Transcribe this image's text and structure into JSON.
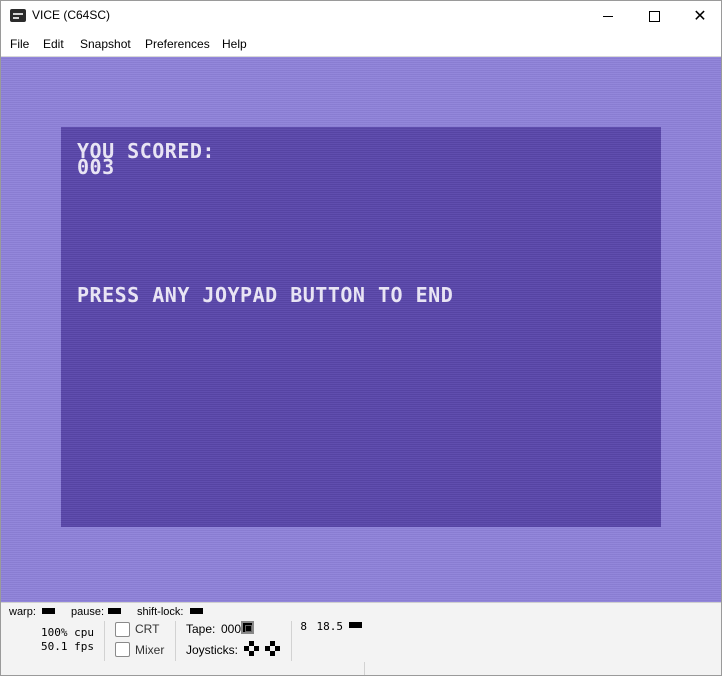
{
  "window": {
    "title": "VICE (C64SC)",
    "controls": {
      "minimize": "minimize",
      "maximize": "maximize",
      "close": "✕"
    }
  },
  "menu": [
    "File",
    "Edit",
    "Snapshot",
    "Preferences",
    "Help"
  ],
  "screen": {
    "line1": "YOU SCORED:",
    "line2": "003",
    "line3": "PRESS ANY JOYPAD BUTTON TO END",
    "border_color": "#8f82da",
    "background_color": "#5b48ac",
    "text_color": "#e8e4f4"
  },
  "status": {
    "warp_label": "warp:",
    "pause_label": "pause:",
    "shiftlock_label": "shift-lock:",
    "cpu": "100% cpu",
    "fps": "50.1 fps",
    "crt_label": "CRT",
    "mixer_label": "Mixer",
    "tape_label": "Tape:",
    "tape_counter": "000",
    "joysticks_label": "Joysticks:",
    "drive_number": "8",
    "drive_track": "18.5"
  }
}
